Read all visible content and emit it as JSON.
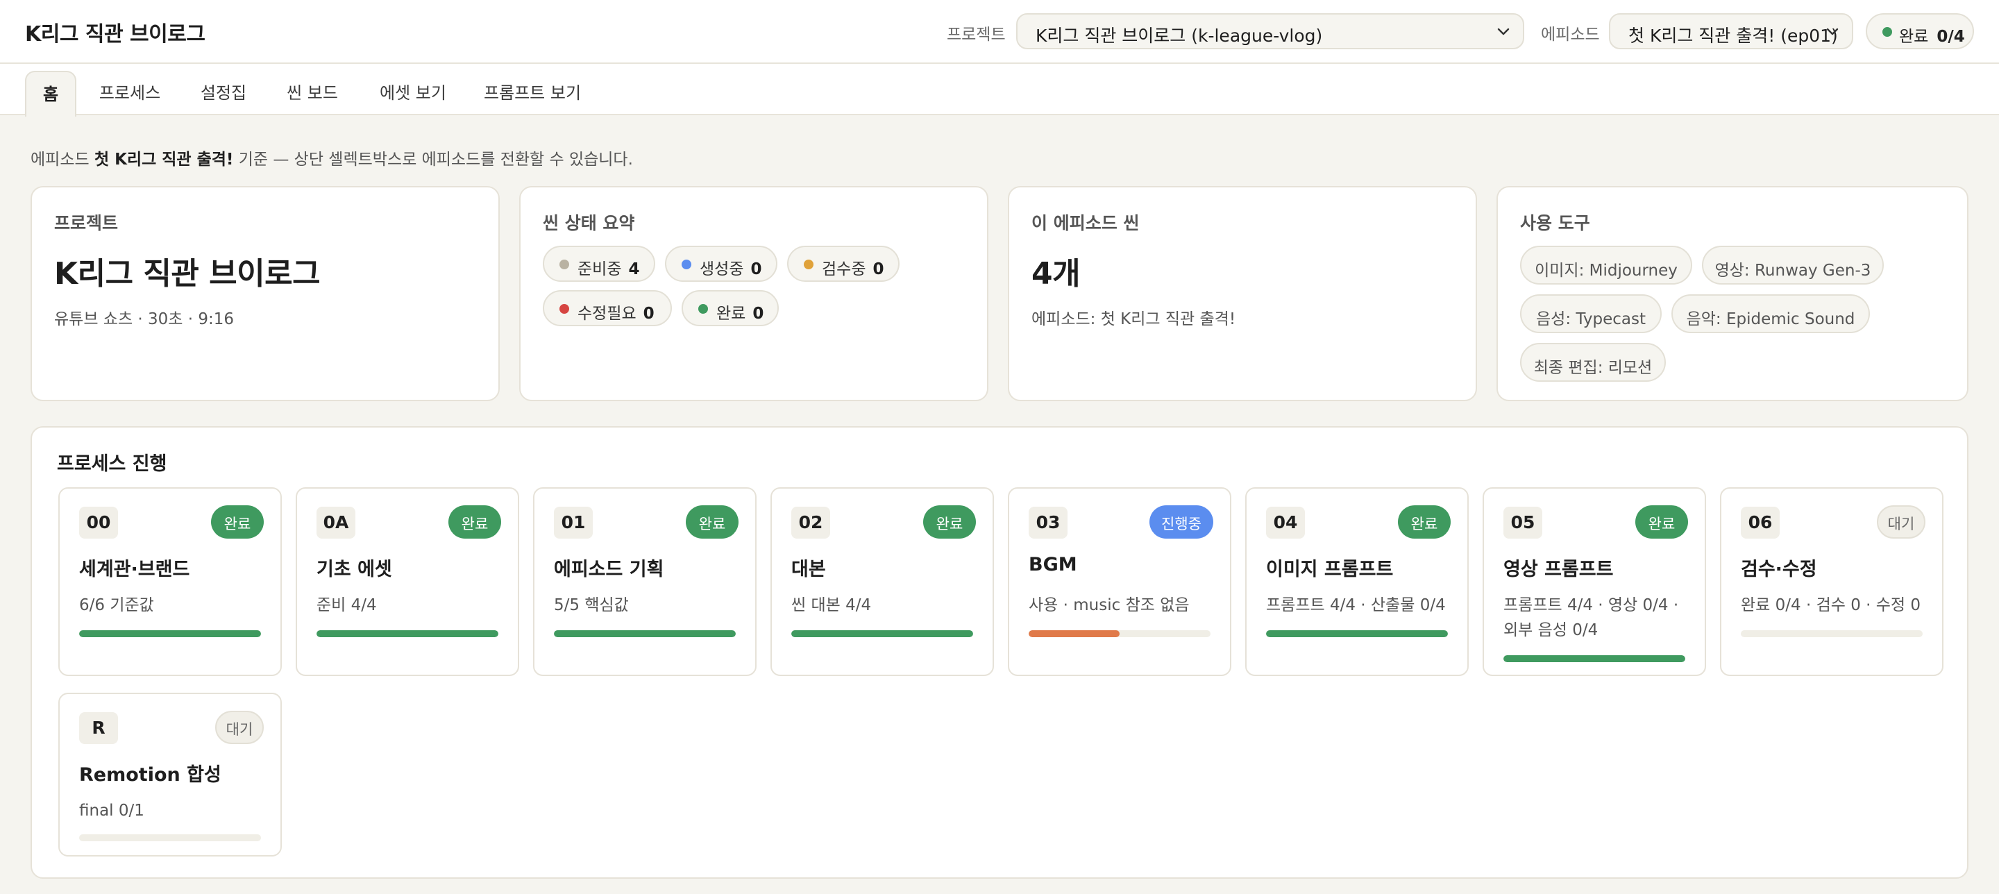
{
  "header": {
    "app_title": "K리그 직관 브이로그",
    "project_label": "프로젝트",
    "project_value": "K리그 직관 브이로그 (k-league-vlog)",
    "episode_label": "에피소드",
    "episode_value": "첫 K리그 직관 출격! (ep01)",
    "done_label": "완료",
    "done_value": "0/4"
  },
  "tabs": [
    {
      "label": "홈",
      "active": true
    },
    {
      "label": "프로세스"
    },
    {
      "label": "설정집"
    },
    {
      "label": "씬 보드"
    },
    {
      "label": "에셋 보기"
    },
    {
      "label": "프롬프트 보기"
    }
  ],
  "notice": {
    "prefix": "에피소드 ",
    "episode": "첫 K리그 직관 출격!",
    "suffix": " 기준 — 상단 셀렉트박스로 에피소드를 전환할 수 있습니다."
  },
  "cards": {
    "project": {
      "heading": "프로젝트",
      "title": "K리그 직관 브이로그",
      "meta": "유튜브 쇼츠 · 30초 · 9:16"
    },
    "scene_status": {
      "heading": "씬 상태 요약",
      "items": [
        {
          "label": "준비중",
          "count": "4",
          "color": "#b9b2a2"
        },
        {
          "label": "생성중",
          "count": "0",
          "color": "#5b8def"
        },
        {
          "label": "검수중",
          "count": "0",
          "color": "#e0a23a"
        },
        {
          "label": "수정필요",
          "count": "0",
          "color": "#d64541"
        },
        {
          "label": "완료",
          "count": "0",
          "color": "#3f9a5f"
        }
      ]
    },
    "episode_scenes": {
      "heading": "이 에피소드 씬",
      "count": "4개",
      "meta": "에피소드: 첫 K리그 직관 출격!"
    },
    "tools": {
      "heading": "사용 도구",
      "items": [
        "이미지: Midjourney",
        "영상: Runway Gen-3",
        "음성: Typecast",
        "음악: Epidemic Sound",
        "최종 편집: 리모션"
      ]
    }
  },
  "process": {
    "title": "프로세스 진행",
    "steps": [
      {
        "code": "00",
        "status": "완료",
        "state": "done",
        "name": "세계관·브랜드",
        "desc": "6/6 기준값",
        "progress": 1.0,
        "color": "#3f9a5f"
      },
      {
        "code": "0A",
        "status": "완료",
        "state": "done",
        "name": "기초 에셋",
        "desc": "준비 4/4",
        "progress": 1.0,
        "color": "#3f9a5f"
      },
      {
        "code": "01",
        "status": "완료",
        "state": "done",
        "name": "에피소드 기획",
        "desc": "5/5 핵심값",
        "progress": 1.0,
        "color": "#3f9a5f"
      },
      {
        "code": "02",
        "status": "완료",
        "state": "done",
        "name": "대본",
        "desc": "씬 대본 4/4",
        "progress": 1.0,
        "color": "#3f9a5f"
      },
      {
        "code": "03",
        "status": "진행중",
        "state": "prog",
        "name": "BGM",
        "desc": "사용 · music 참조 없음",
        "progress": 0.5,
        "color": "#e07a4a"
      },
      {
        "code": "04",
        "status": "완료",
        "state": "done",
        "name": "이미지 프롬프트",
        "desc": "프롬프트 4/4 · 산출물 0/4",
        "progress": 1.0,
        "color": "#3f9a5f"
      },
      {
        "code": "05",
        "status": "완료",
        "state": "done",
        "name": "영상 프롬프트",
        "desc": "프롬프트 4/4 · 영상 0/4 · 외부 음성 0/4",
        "progress": 1.0,
        "color": "#3f9a5f"
      },
      {
        "code": "06",
        "status": "대기",
        "state": "wait",
        "name": "검수·수정",
        "desc": "완료 0/4 · 검수 0 · 수정 0",
        "progress": 0.0,
        "color": "#3f9a5f"
      },
      {
        "code": "R",
        "status": "대기",
        "state": "wait",
        "name": "Remotion 합성",
        "desc": "final 0/1",
        "progress": 0.0,
        "color": "#3f9a5f"
      }
    ]
  }
}
